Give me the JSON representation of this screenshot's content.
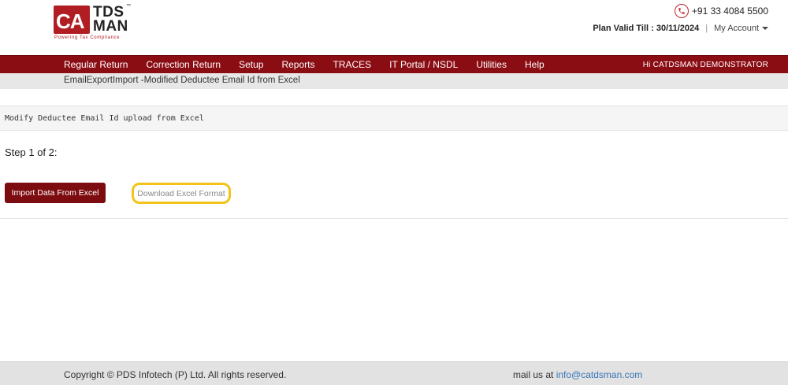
{
  "header": {
    "logo": {
      "ca": "CA",
      "tds": "TDS",
      "man": "MAN",
      "tm": "™",
      "tagline": "Powering Tax Compliance"
    },
    "phone": "+91 33 4084 5500",
    "plan_label": "Plan Valid Till : 30/11/2024",
    "separator": "|",
    "my_account": "My Account"
  },
  "nav": {
    "items": [
      "Regular Return",
      "Correction Return",
      "Setup",
      "Reports",
      "TRACES",
      "IT Portal / NSDL",
      "Utilities",
      "Help"
    ],
    "user_greeting": "Hi CATDSMAN DEMONSTRATOR"
  },
  "breadcrumb": "EmailExportImport -Modified Deductee Email Id from Excel",
  "section_title": "Modify Deductee Email Id upload from Excel",
  "step_label": "Step 1 of 2:",
  "buttons": {
    "import": "Import Data From Excel",
    "download": "Download Excel Format"
  },
  "footer": {
    "copyright": "Copyright © PDS Infotech (P) Ltd. All rights reserved.",
    "mail_prefix": "mail us at ",
    "mail_link": "info@catdsman.com"
  },
  "colors": {
    "brand_red": "#8b0d14",
    "button_red": "#7d0c10",
    "highlight_yellow": "#f2c318",
    "link_blue": "#3a76b8"
  }
}
